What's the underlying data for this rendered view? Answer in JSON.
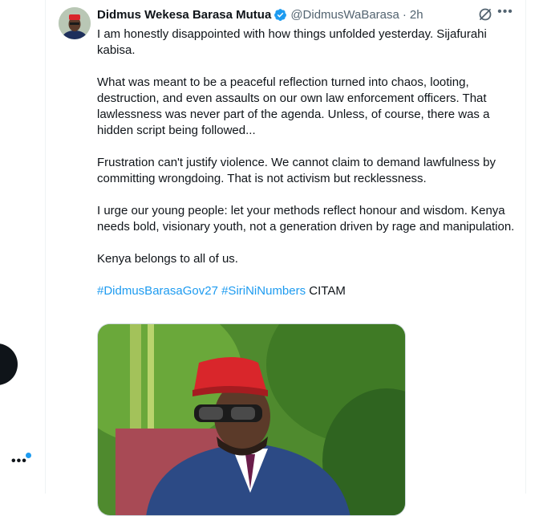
{
  "tweet": {
    "display_name": "Didmus Wekesa Barasa Mutua",
    "handle": "@DidmusWaBarasa",
    "separator": "·",
    "time": "2h",
    "paragraphs": [
      "I am honestly disappointed with how things unfolded yesterday. Sijafurahi kabisa.",
      "What was meant to be a peaceful reflection turned into chaos, looting, destruction, and even assaults on our own law enforcement officers. That lawlessness was never part of the agenda. Unless, of course, there was a hidden script being followed...",
      "Frustration can't justify violence. We cannot claim to demand lawfulness by committing wrongdoing. That is not activism but recklessness.",
      "I urge our young people: let your methods reflect honour and wisdom. Kenya needs bold, visionary youth, not a generation driven by rage and manipulation.",
      "Kenya belongs to all of us."
    ],
    "hashtags": [
      "#DidmusBarasaGov27",
      "#SiriNiNumbers"
    ],
    "trailing_text": "CITAM",
    "colors": {
      "text": "#0f1419",
      "secondary": "#536471",
      "link": "#1d9bf0",
      "verified": "#1d9bf0"
    }
  },
  "icons": {
    "verified": "verified-badge-icon",
    "grok": "grok-icon",
    "more": "more-icon"
  }
}
